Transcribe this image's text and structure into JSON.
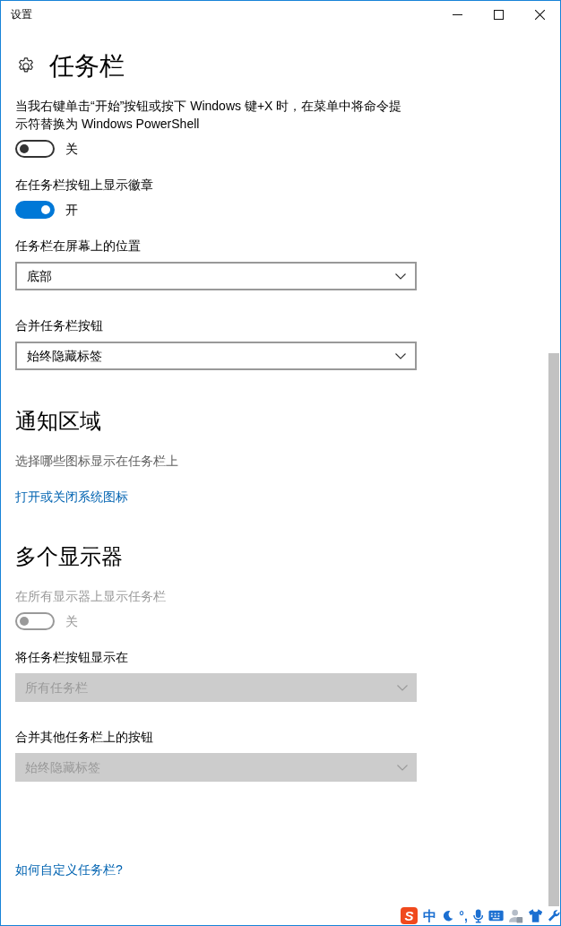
{
  "window": {
    "title": "设置"
  },
  "page_title": "任务栏",
  "items": [
    {
      "kind": "toggle",
      "label": "当我右键单击“开始”按钮或按下 Windows 键+X 时，在菜单中将命令提示符替换为 Windows PowerShell",
      "on": false,
      "state_text": "关",
      "disabled": false
    },
    {
      "kind": "toggle",
      "label": "在任务栏按钮上显示徽章",
      "on": true,
      "state_text": "开",
      "disabled": false
    },
    {
      "kind": "dropdown",
      "label": "任务栏在屏幕上的位置",
      "value": "底部",
      "disabled": false
    },
    {
      "kind": "dropdown",
      "label": "合并任务栏按钮",
      "value": "始终隐藏标签",
      "disabled": false
    },
    {
      "kind": "heading",
      "text": "通知区域"
    },
    {
      "kind": "text",
      "text": "选择哪些图标显示在任务栏上"
    },
    {
      "kind": "link",
      "text": "打开或关闭系统图标"
    },
    {
      "kind": "heading",
      "text": "多个显示器"
    },
    {
      "kind": "toggle",
      "label": "在所有显示器上显示任务栏",
      "on": false,
      "state_text": "关",
      "disabled": true
    },
    {
      "kind": "dropdown",
      "label": "将任务栏按钮显示在",
      "value": "所有任务栏",
      "disabled": true
    },
    {
      "kind": "dropdown",
      "label": "合并其他任务栏上的按钮",
      "value": "始终隐藏标签",
      "disabled": true
    }
  ],
  "footer_link": "如何自定义任务栏?",
  "ime_toolbar": {
    "logo": "S",
    "mode": "中",
    "punctuation": "°,"
  }
}
